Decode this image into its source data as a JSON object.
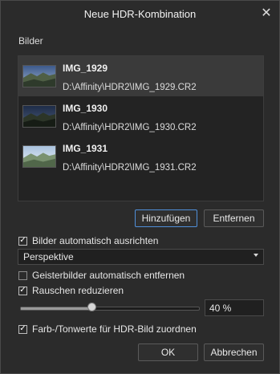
{
  "window": {
    "title": "Neue HDR-Kombination",
    "close_label": "✕"
  },
  "images_section": {
    "label": "Bilder"
  },
  "images": [
    {
      "name": "IMG_1929",
      "path": "D:\\Affinity\\HDR2\\IMG_1929.CR2"
    },
    {
      "name": "IMG_1930",
      "path": "D:\\Affinity\\HDR2\\IMG_1930.CR2"
    },
    {
      "name": "IMG_1931",
      "path": "D:\\Affinity\\HDR2\\IMG_1931.CR2"
    }
  ],
  "list_buttons": {
    "add": "Hinzufügen",
    "remove": "Entfernen"
  },
  "options": {
    "auto_align": {
      "label": "Bilder automatisch ausrichten",
      "checked": true
    },
    "align_method": {
      "selected": "Perspektive"
    },
    "ghost_removal": {
      "label": "Geisterbilder automatisch entfernen",
      "checked": false
    },
    "noise_reduction": {
      "label": "Rauschen reduzieren",
      "checked": true,
      "value": 40,
      "value_text": "40 %"
    },
    "tone_map": {
      "label": "Farb-/Tonwerte für HDR-Bild zuordnen",
      "checked": true
    }
  },
  "footer": {
    "ok": "OK",
    "cancel": "Abbrechen"
  },
  "colors": {
    "focus": "#4f8fd9",
    "background": "#2b2b2b",
    "selected_row": "#3a3a3a"
  }
}
